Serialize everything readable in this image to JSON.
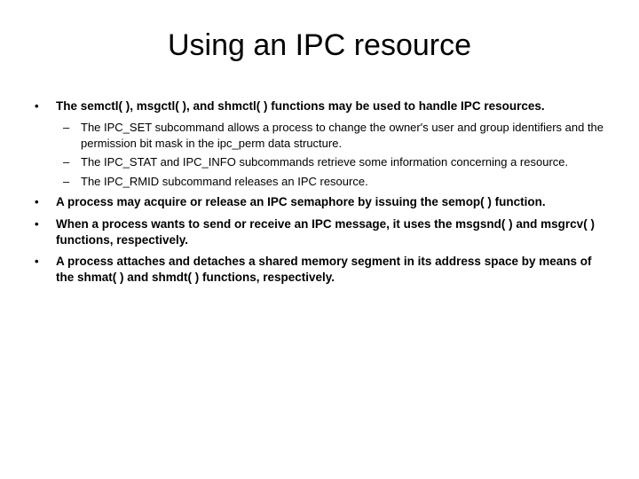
{
  "title": "Using an IPC resource",
  "bullets": [
    {
      "text": "The semctl( ), msgctl( ), and shmctl( ) functions may be used to handle IPC resources.",
      "bold": true,
      "subs": [
        "The IPC_SET subcommand allows a process to change the owner's user and group identifiers and the permission bit mask in the ipc_perm data structure.",
        "The IPC_STAT and IPC_INFO subcommands retrieve some information concerning a resource.",
        "The IPC_RMID subcommand releases an IPC resource."
      ]
    },
    {
      "text": "A process may acquire or release an IPC semaphore by issuing the semop( ) function.",
      "bold": true,
      "subs": []
    },
    {
      "text": "When a process wants to send or receive an IPC message, it uses the msgsnd( ) and msgrcv( ) functions, respectively.",
      "bold": true,
      "subs": []
    },
    {
      "text": "A process attaches and detaches a shared memory segment in its address space by means of the shmat( ) and shmdt( ) functions, respectively.",
      "bold": true,
      "subs": []
    }
  ]
}
